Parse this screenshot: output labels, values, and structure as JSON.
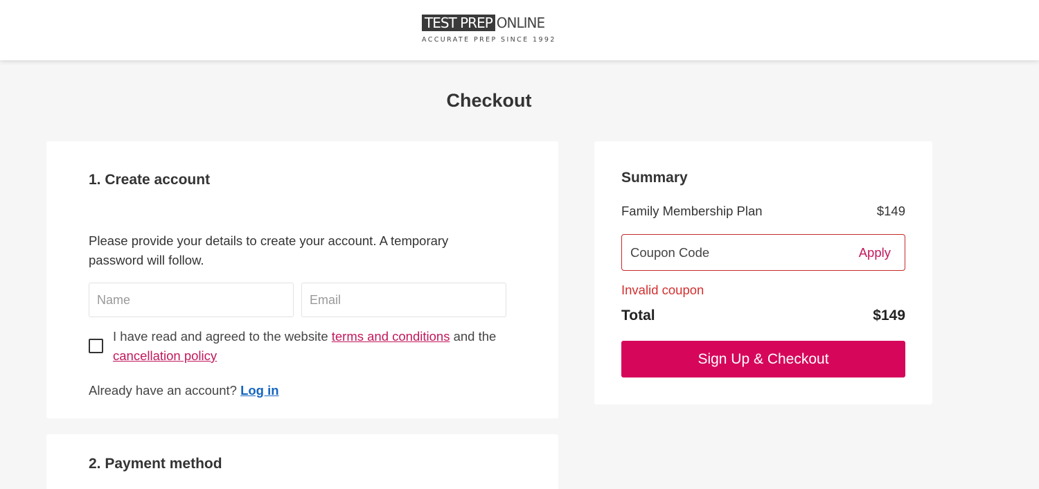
{
  "header": {
    "logo_test_prep": "TEST PREP",
    "logo_online": "ONLINE",
    "logo_tagline": "ACCURATE PREP SINCE 1992"
  },
  "page": {
    "title": "Checkout"
  },
  "account": {
    "heading": "1. Create account",
    "intro": "Please provide your details to create your account. A temporary password will follow.",
    "name_placeholder": "Name",
    "email_placeholder": "Email",
    "agree_prefix": "I have read and agreed to the website",
    "terms_link": "terms and conditions",
    "agree_mid": "and the",
    "cancellation_link": "cancellation policy",
    "login_prompt": "Already have an account?",
    "login_link": "Log in"
  },
  "payment": {
    "heading": "2. Payment method"
  },
  "summary": {
    "heading": "Summary",
    "plan_name": "Family Membership Plan",
    "plan_price": "$149",
    "coupon_placeholder": "Coupon Code",
    "apply_label": "Apply",
    "coupon_error": "Invalid coupon",
    "total_label": "Total",
    "total_value": "$149",
    "checkout_label": "Sign Up & Checkout"
  },
  "colors": {
    "brand_pink": "#d6075b",
    "link_pink": "#c2185b",
    "link_blue": "#1565c0",
    "error_red": "#d32f2f"
  }
}
